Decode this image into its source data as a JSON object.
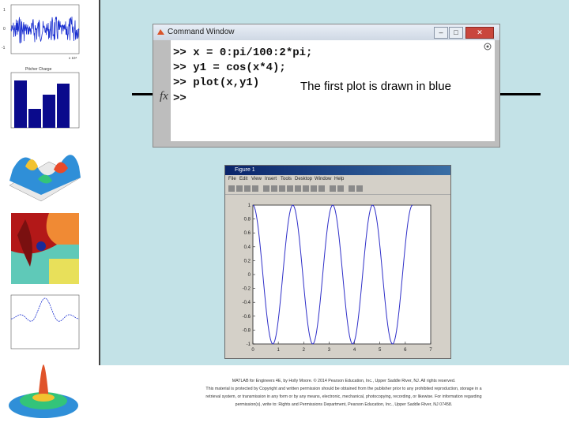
{
  "command_window": {
    "title": "Command Window",
    "lines": [
      "x = 0:pi/100:2*pi;",
      "y1 = cos(x*4);",
      "plot(x,y1)",
      ""
    ],
    "prompt": ">>",
    "fx_label": "fx",
    "note": "The first plot is drawn in blue"
  },
  "figure_window": {
    "title": "Figure 1",
    "menu": [
      "File",
      "Edit",
      "View",
      "Insert",
      "Tools",
      "Desktop",
      "Window",
      "Help"
    ]
  },
  "chart_data": {
    "type": "line",
    "x_expression": "0:pi/100:2*pi",
    "y_expression": "cos(x*4)",
    "xlim": [
      0,
      7
    ],
    "ylim": [
      -1,
      1
    ],
    "xticks": [
      0,
      1,
      2,
      3,
      4,
      5,
      6,
      7
    ],
    "yticks": [
      -1,
      -0.8,
      -0.6,
      -0.4,
      -0.2,
      0,
      0.2,
      0.4,
      0.6,
      0.8,
      1
    ],
    "series": [
      {
        "color": "#2f2fc8",
        "x_start": 0,
        "x_end": 6.283185,
        "points": 201,
        "frequency": 4
      }
    ]
  },
  "thumbnails": {
    "plot1_xlabel": "x 10⁴",
    "plot2_title": "Pitcher Charge",
    "plot1_yticks": [
      "1",
      "0",
      "-1"
    ]
  },
  "footer": {
    "line1": "MATLAB for Engineers 4E, by Holly Moore. © 2014 Pearson Education, Inc., Upper Saddle River, NJ. All rights reserved.",
    "line2": "This material is protected by Copyright and written permission should be obtained from the publisher prior to any prohibited reproduction, storage in a",
    "line3": "retrieval system, or transmission in any form or by any means, electronic, mechanical, photocopying, recording, or likewise. For information regarding",
    "line4": "permission(s), write to: Rights and Permissions Department, Pearson Education, Inc., Upper Saddle River, NJ 07458."
  },
  "colors": {
    "slide_bg": "#c3e2e7",
    "plot_line": "#2f2fc8"
  }
}
